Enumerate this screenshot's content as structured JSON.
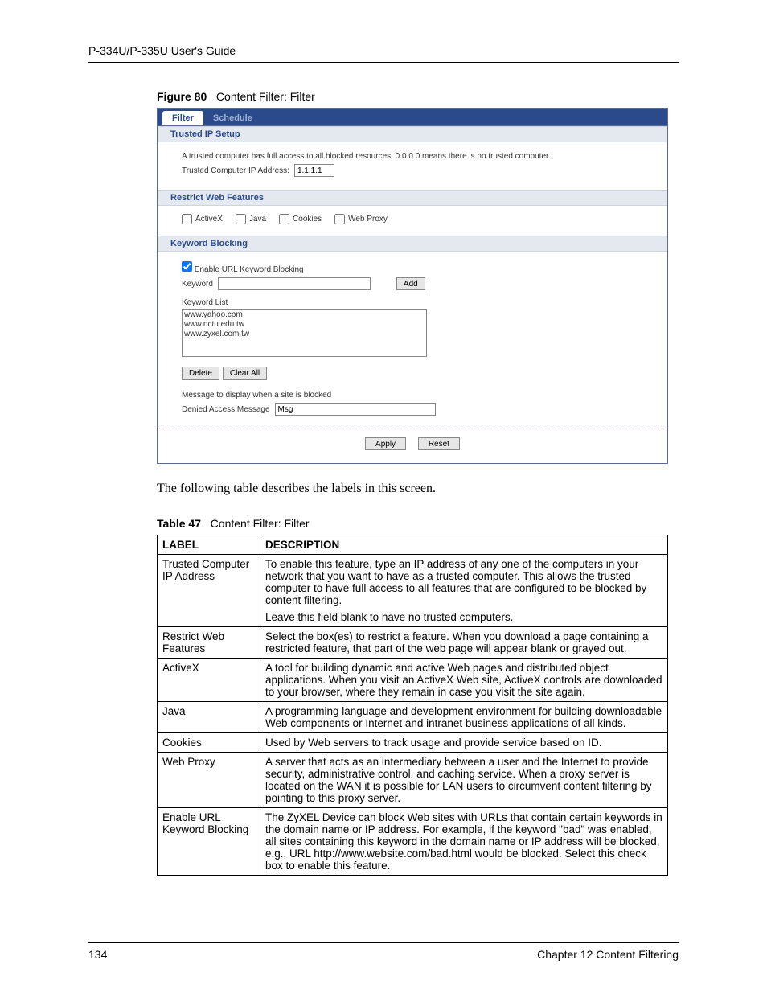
{
  "header": {
    "guide_title": "P-334U/P-335U User's Guide"
  },
  "figure": {
    "label": "Figure 80",
    "caption": "Content Filter: Filter"
  },
  "tabs": {
    "active": "Filter",
    "inactive": "Schedule"
  },
  "trusted": {
    "heading": "Trusted IP Setup",
    "desc": "A trusted computer has full access to all blocked resources. 0.0.0.0 means there is no trusted computer.",
    "ip_label": "Trusted Computer IP Address:",
    "ip_value": "1.1.1.1"
  },
  "restrict": {
    "heading": "Restrict Web Features",
    "items": [
      "ActiveX",
      "Java",
      "Cookies",
      "Web Proxy"
    ]
  },
  "keyword": {
    "heading": "Keyword Blocking",
    "enable_label": "Enable URL Keyword Blocking",
    "keyword_label": "Keyword",
    "add_btn": "Add",
    "list_label": "Keyword List",
    "list": [
      "www.yahoo.com",
      "www.nctu.edu.tw",
      "www.zyxel.com.tw"
    ],
    "delete_btn": "Delete",
    "clear_btn": "Clear All",
    "msg_caption": "Message to display when a site is blocked",
    "denied_label": "Denied Access Message",
    "denied_value": "Msg"
  },
  "footer_btns": {
    "apply": "Apply",
    "reset": "Reset"
  },
  "prose": "The following table describes the labels in this screen.",
  "table": {
    "label": "Table 47",
    "caption": "Content Filter: Filter",
    "head_label": "LABEL",
    "head_desc": "DESCRIPTION",
    "rows": [
      {
        "label": "Trusted Computer IP Address",
        "desc": [
          "To enable this feature, type an IP address of any one of the computers in your network that you want to have as a trusted computer. This allows the trusted computer to have full access to all features that are configured to be blocked by content filtering.",
          "Leave this field blank to have no trusted computers."
        ]
      },
      {
        "label": "Restrict Web Features",
        "desc": [
          "Select the box(es) to restrict a feature. When you download a page containing a restricted feature, that part of the web page will appear blank or grayed out."
        ]
      },
      {
        "label": "ActiveX",
        "desc": [
          "A tool for building dynamic and active Web pages and distributed object applications. When you visit an ActiveX Web site, ActiveX controls are downloaded to your browser, where they remain in case you visit the site again."
        ]
      },
      {
        "label": "Java",
        "desc": [
          "A programming language and development environment for building downloadable Web components or Internet and intranet business applications of all kinds."
        ]
      },
      {
        "label": "Cookies",
        "desc": [
          "Used by Web servers to track usage and provide service based on ID."
        ]
      },
      {
        "label": "Web Proxy",
        "desc": [
          "A server that acts as an intermediary between a user and the Internet to provide security, administrative control, and caching service. When a proxy server is located on the WAN it is possible for LAN users to circumvent content filtering by pointing to this proxy server."
        ]
      },
      {
        "label": "Enable URL Keyword Blocking",
        "desc": [
          "The ZyXEL Device can block Web sites with URLs that contain certain keywords in the domain name or IP address. For example, if the keyword \"bad\" was enabled, all sites containing this keyword in the domain name or IP address will be blocked, e.g., URL http://www.website.com/bad.html would be blocked. Select this check box to enable this feature."
        ]
      }
    ]
  },
  "pagefoot": {
    "pagenum": "134",
    "chapter": "Chapter 12 Content Filtering"
  }
}
